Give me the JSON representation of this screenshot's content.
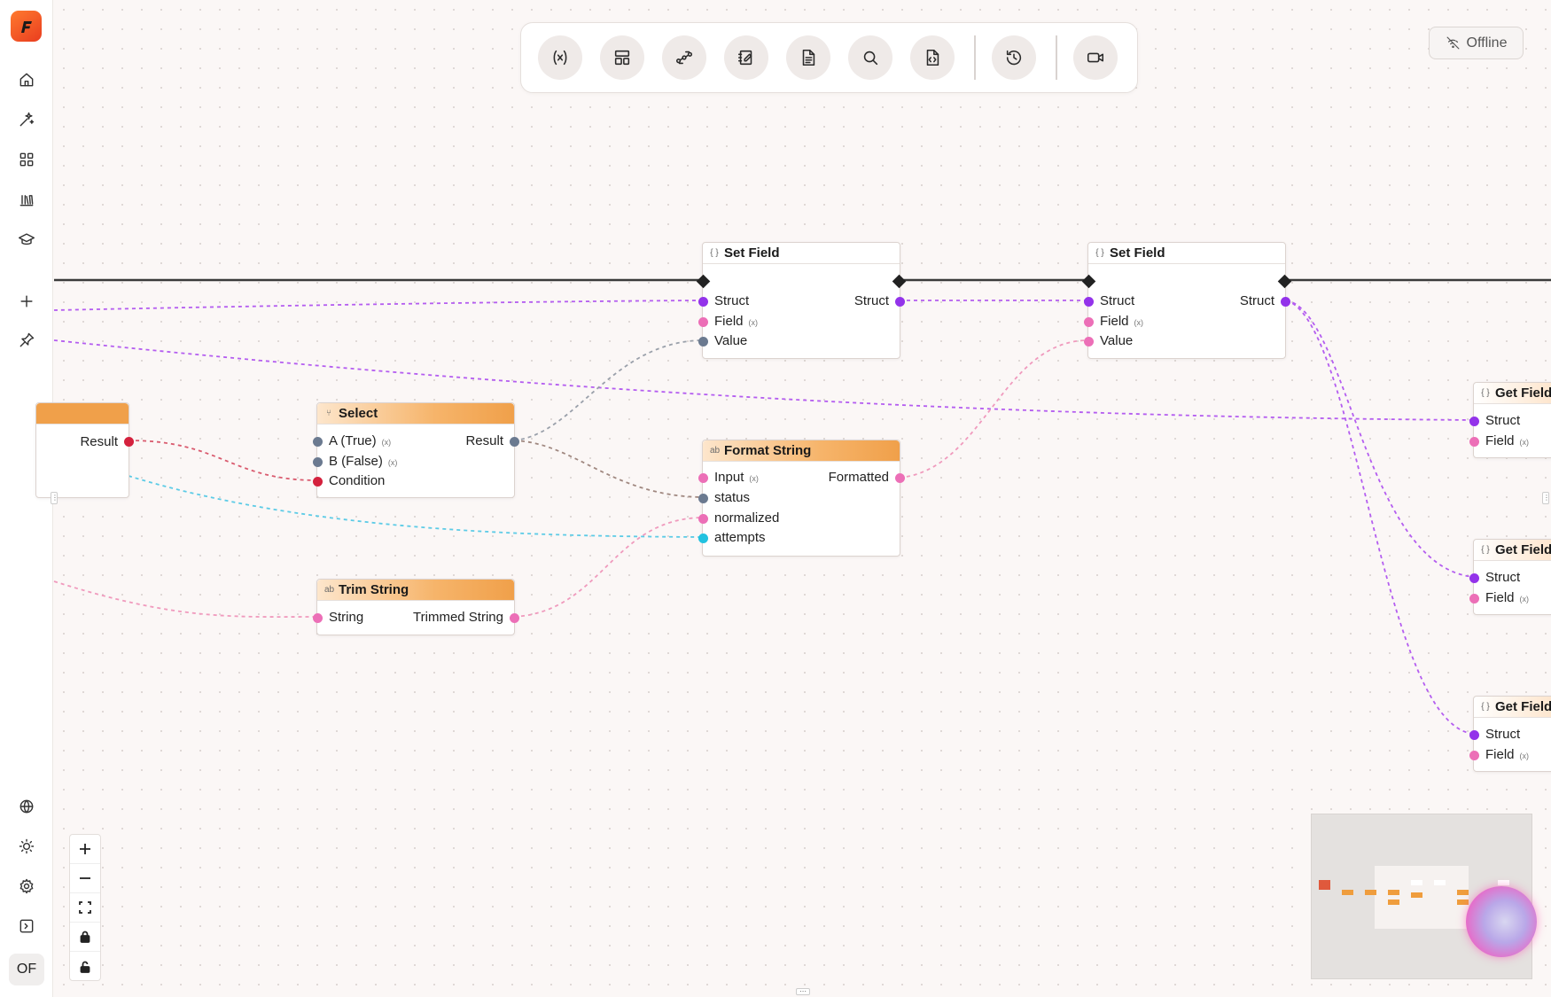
{
  "app": {
    "user_initials": "OF",
    "status_label": "Offline"
  },
  "sidebar": {
    "top_icons": [
      "home-icon",
      "sparkle-icon",
      "grid-icon",
      "library-icon",
      "graduation-icon",
      "plus-icon",
      "pin-icon"
    ],
    "bottom_icons": [
      "globe-icon",
      "sun-icon",
      "settings-icon",
      "panel-toggle-icon"
    ]
  },
  "toolbar": {
    "buttons": [
      "variables-icon",
      "layout-icon",
      "workflow-icon",
      "notes-icon",
      "document-icon",
      "search-icon",
      "code-file-icon",
      "history-icon",
      "video-icon"
    ]
  },
  "nodes": {
    "set_field_1": {
      "title": "Set Field",
      "in_struct": "Struct",
      "in_field": "Field",
      "in_value": "Value",
      "out_struct": "Struct"
    },
    "set_field_2": {
      "title": "Set Field",
      "in_struct": "Struct",
      "in_field": "Field",
      "in_value": "Value",
      "out_struct": "Struct"
    },
    "select": {
      "title": "Select",
      "in_a": "A (True)",
      "in_b": "B (False)",
      "in_condition": "Condition",
      "out_result": "Result"
    },
    "left_partial": {
      "out_result": "Result"
    },
    "format_string": {
      "title": "Format String",
      "in_input": "Input",
      "in_status": "status",
      "in_normalized": "normalized",
      "in_attempts": "attempts",
      "out_formatted": "Formatted"
    },
    "trim_string": {
      "title": "Trim String",
      "in_string": "String",
      "out_trimmed": "Trimmed String"
    },
    "get_field_1": {
      "title": "Get Field",
      "in_struct": "Struct",
      "in_field": "Field"
    },
    "get_field_2": {
      "title": "Get Field",
      "in_struct": "Struct",
      "in_field": "Field"
    },
    "get_field_3": {
      "title": "Get Field",
      "in_struct": "Struct",
      "in_field": "Field"
    }
  },
  "colors": {
    "struct_pin": "#9333ea",
    "string_pin": "#ec6fb7",
    "generic_pin": "#6b7a90",
    "bool_pin": "#d4213d",
    "int_pin": "#22c2e0",
    "node_header_accent": "#f0a04a"
  },
  "zoom_controls": [
    "zoom-in-icon",
    "zoom-out-icon",
    "fit-view-icon",
    "lock-icon",
    "unlock-icon"
  ]
}
